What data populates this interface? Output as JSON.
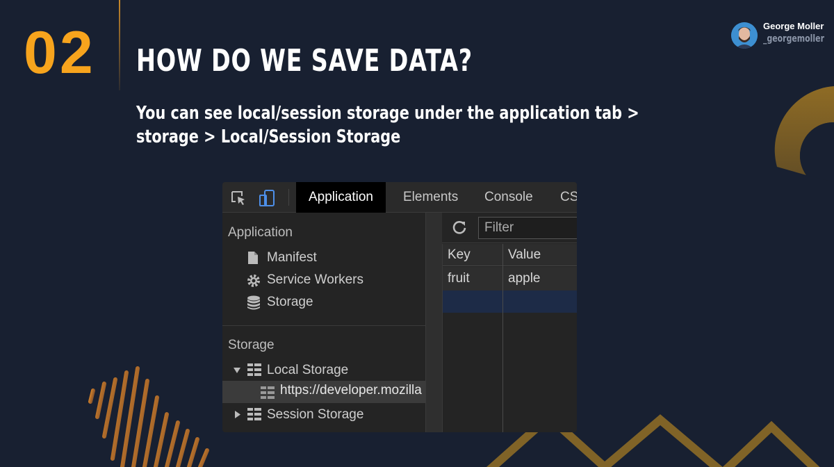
{
  "slide": {
    "number": "02",
    "title": "HOW DO WE SAVE DATA?",
    "subtitle_line1": "You can see local/session storage under the application tab >",
    "subtitle_line2": "storage > Local/Session Storage"
  },
  "author": {
    "name": "George Moller",
    "handle": "_georgemoller"
  },
  "colors": {
    "background": "#182031",
    "accent": "#f7a41d",
    "accent_dark": "#c9892a"
  },
  "devtools": {
    "toolbar": {
      "inspect_icon": "element-picker-icon",
      "device_icon": "device-toolbar-icon",
      "tabs": [
        "Application",
        "Elements",
        "Console",
        "CS"
      ]
    },
    "sidebar": {
      "application_section": "Application",
      "application_items": [
        {
          "label": "Manifest",
          "icon": "file-icon"
        },
        {
          "label": "Service Workers",
          "icon": "gear-icon"
        },
        {
          "label": "Storage",
          "icon": "database-icon"
        }
      ],
      "storage_section": "Storage",
      "local_storage": "Local Storage",
      "local_storage_origin": "https://developer.mozilla",
      "session_storage": "Session Storage"
    },
    "main": {
      "filter_placeholder": "Filter",
      "columns": [
        "Key",
        "Value"
      ],
      "rows": [
        {
          "key": "fruit",
          "value": "apple"
        }
      ]
    }
  }
}
